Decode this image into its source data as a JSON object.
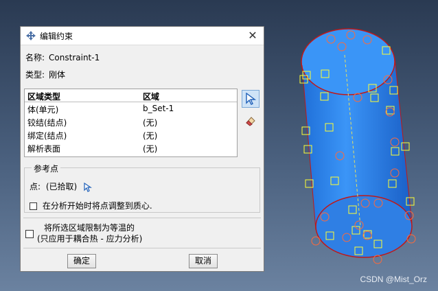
{
  "dialog": {
    "title": "编辑约束",
    "name_label": "名称:",
    "name_value": "Constraint-1",
    "type_label": "类型:",
    "type_value": "刚体",
    "table": {
      "headers": [
        "区域类型",
        "区域"
      ],
      "rows": [
        [
          "体(单元)",
          "b_Set-1"
        ],
        [
          "铰结(结点)",
          "(无)"
        ],
        [
          "绑定(结点)",
          "(无)"
        ],
        [
          "解析表面",
          "(无)"
        ]
      ]
    },
    "ref_group_title": "参考点",
    "point_label": "点:",
    "point_value": "(已拾取)",
    "adjust_label": "在分析开始时将点调整到质心.",
    "isothermal_line1": "将所选区域限制为等温的",
    "isothermal_line2": "(只应用于耦合热 - 应力分析)",
    "ok_label": "确定",
    "cancel_label": "取消"
  },
  "watermark": "CSDN @Mist_Orz",
  "colors": {
    "cylinder": "#2f88f0",
    "marker_square": "#ffff33",
    "marker_circle": "#ff6a3a",
    "edge": "#c01818"
  }
}
